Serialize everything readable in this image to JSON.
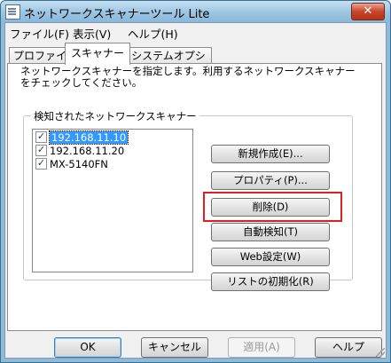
{
  "window": {
    "title": "ネットワークスキャナーツール Lite",
    "close_label": "✕"
  },
  "menu": [
    "ファイル(F)",
    "表示(V)",
    "ヘルプ(H)"
  ],
  "tabs": [
    {
      "label": "プロファイル",
      "active": false
    },
    {
      "label": "スキャナー",
      "active": true
    },
    {
      "label": "システムオプション",
      "active": false
    }
  ],
  "scanner_tab": {
    "description": "ネットワークスキャナーを指定します。利用するネットワークスキャナーをチェックしてください。",
    "group_label": "検知されたネットワークスキャナー",
    "scanners": [
      {
        "name": "192.168.11.10",
        "checked": true,
        "selected": true
      },
      {
        "name": "192.168.11.20",
        "checked": true,
        "selected": false
      },
      {
        "name": "MX-5140FN",
        "checked": true,
        "selected": false
      }
    ],
    "buttons": {
      "new": "新規作成(E)...",
      "properties": "プロパティ(P)...",
      "delete": "削除(D)",
      "auto_detect": "自動検知(T)",
      "web_settings": "Web設定(W)",
      "reset_list": "リストの初期化(R)"
    }
  },
  "footer": {
    "ok": "OK",
    "cancel": "キャンセル",
    "apply": "適用(A)",
    "help": "ヘルプ"
  },
  "colors": {
    "highlight_border": "#e02020",
    "selection": "#3399ff"
  }
}
